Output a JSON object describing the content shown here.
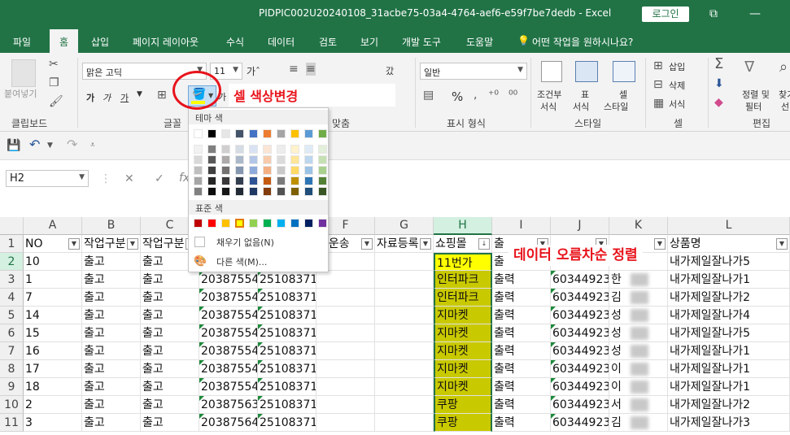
{
  "window": {
    "title": "PIDPIC002U20240108_31acbe75-03a4-4764-aef6-e59f7be7dedb  -  Excel",
    "login": "로그인"
  },
  "tabs": [
    "파일",
    "홈",
    "삽입",
    "페이지 레이아웃",
    "수식",
    "데이터",
    "검토",
    "보기",
    "개발 도구",
    "도움말",
    "어떤 작업을 원하시나요?"
  ],
  "ribbon": {
    "clipboard": {
      "paste": "붙여넣기",
      "label": "클립보드"
    },
    "font": {
      "name": "맑은 고딕",
      "size": "11",
      "bold": "가",
      "italic": "가",
      "underline": "가",
      "label": "글꼴"
    },
    "align": {
      "label": "맞춤"
    },
    "number": {
      "format": "일반",
      "label": "표시 형식",
      "percent": "%"
    },
    "styles": {
      "cond1": "조건부",
      "cond2": "서식",
      "table1": "표",
      "table2": "서식",
      "cell1": "셀",
      "cell2": "스타일",
      "label": "스타일"
    },
    "cells": {
      "insert": "삽입",
      "delete": "삭제",
      "format": "서식",
      "label": "셀"
    },
    "editing": {
      "sort1": "정렬 및",
      "sort2": "필터",
      "find1": "찾기",
      "find2": "선",
      "label": "편집"
    }
  },
  "formula_bar": {
    "name_box": "H2",
    "cancel": "✕",
    "confirm": "✓",
    "fx": "fx"
  },
  "color_popup": {
    "theme_header": "테마 색",
    "standard_header": "표준 색",
    "no_fill": "채우기 없음(N)",
    "more_colors": "다른 색(M)...",
    "theme_top": [
      "#ffffff",
      "#000000",
      "#e7e6e6",
      "#44546a",
      "#4472c4",
      "#ed7d31",
      "#a5a5a5",
      "#ffc000",
      "#5b9bd5",
      "#70ad47"
    ],
    "theme_shades": [
      [
        "#f2f2f2",
        "#d9d9d9",
        "#bfbfbf",
        "#a6a6a6",
        "#808080"
      ],
      [
        "#808080",
        "#595959",
        "#404040",
        "#262626",
        "#0d0d0d"
      ],
      [
        "#d0cece",
        "#aeaaaa",
        "#757171",
        "#3a3838",
        "#171616"
      ],
      [
        "#d6dce4",
        "#acb9ca",
        "#8496b0",
        "#333f4f",
        "#222a35"
      ],
      [
        "#d9e2f3",
        "#b4c6e7",
        "#8eaadb",
        "#2f5496",
        "#1f3864"
      ],
      [
        "#fbe5d5",
        "#f7cbac",
        "#f4b083",
        "#c55a11",
        "#833c0b"
      ],
      [
        "#ededed",
        "#dbdbdb",
        "#c9c9c9",
        "#7b7b7b",
        "#525252"
      ],
      [
        "#fff2cc",
        "#fee599",
        "#ffd965",
        "#bf8f00",
        "#7f6000"
      ],
      [
        "#deebf6",
        "#bdd7ee",
        "#9cc3e5",
        "#2e75b5",
        "#1f4e79"
      ],
      [
        "#e2efd9",
        "#c5e0b3",
        "#a8d08d",
        "#538135",
        "#375623"
      ]
    ],
    "standard": [
      "#c00000",
      "#ff0000",
      "#ffc000",
      "#ffff00",
      "#92d050",
      "#00b050",
      "#00b0f0",
      "#0070c0",
      "#002060",
      "#7030a0"
    ]
  },
  "annotations": {
    "fill_color": "셀 색상변경",
    "sort": "데이터 오름차순 정렬"
  },
  "grid": {
    "columns": [
      "A",
      "B",
      "C",
      "D",
      "E",
      "F",
      "G",
      "H",
      "I",
      "J",
      "K",
      "L"
    ],
    "headers": [
      "NO",
      "작업구분",
      "작업구분",
      "",
      "",
      "전운송",
      "자료등록",
      "쇼핑몰",
      "출",
      "",
      "",
      "상품명"
    ],
    "rows": [
      {
        "n": "2",
        "a": "10",
        "b": "출고",
        "c": "출고",
        "d": "",
        "e": "",
        "h": "11번가",
        "i": "출",
        "j": "",
        "k": "",
        "l": "내가제일잘나가5"
      },
      {
        "n": "3",
        "a": "1",
        "b": "출고",
        "c": "출고",
        "d": "20387554",
        "e": "25108371",
        "h": "인터파크",
        "i": "출력",
        "j": "60344923",
        "k": "한",
        "l": "내가제일잘나가1"
      },
      {
        "n": "4",
        "a": "7",
        "b": "출고",
        "c": "출고",
        "d": "20387554",
        "e": "25108371",
        "h": "인터파크",
        "i": "출력",
        "j": "60344923",
        "k": "김",
        "l": "내가제일잘나가2"
      },
      {
        "n": "5",
        "a": "14",
        "b": "출고",
        "c": "출고",
        "d": "20387554",
        "e": "25108371",
        "h": "지마켓",
        "i": "출력",
        "j": "60344923",
        "k": "성",
        "l": "내가제일잘나가4"
      },
      {
        "n": "6",
        "a": "15",
        "b": "출고",
        "c": "출고",
        "d": "20387554",
        "e": "25108371",
        "h": "지마켓",
        "i": "출력",
        "j": "60344923",
        "k": "성",
        "l": "내가제일잘나가5"
      },
      {
        "n": "7",
        "a": "16",
        "b": "출고",
        "c": "출고",
        "d": "20387554",
        "e": "25108371",
        "h": "지마켓",
        "i": "출력",
        "j": "60344923",
        "k": "성",
        "l": "내가제일잘나가1"
      },
      {
        "n": "8",
        "a": "17",
        "b": "출고",
        "c": "출고",
        "d": "20387554",
        "e": "25108371",
        "h": "지마켓",
        "i": "출력",
        "j": "60344923",
        "k": "이",
        "l": "내가제일잘나가1"
      },
      {
        "n": "9",
        "a": "18",
        "b": "출고",
        "c": "출고",
        "d": "20387554",
        "e": "25108371",
        "h": "지마켓",
        "i": "출력",
        "j": "60344923",
        "k": "이",
        "l": "내가제일잘나가1"
      },
      {
        "n": "10",
        "a": "2",
        "b": "출고",
        "c": "출고",
        "d": "20387563",
        "e": "25108371",
        "h": "쿠팡",
        "i": "출력",
        "j": "60344923",
        "k": "서",
        "l": "내가제일잘나가2"
      },
      {
        "n": "11",
        "a": "3",
        "b": "출고",
        "c": "출고",
        "d": "20387564",
        "e": "25108371",
        "h": "쿠팡",
        "i": "출력",
        "j": "60344923",
        "k": "김",
        "l": "내가제일잘나가3"
      }
    ],
    "row1": "1"
  }
}
